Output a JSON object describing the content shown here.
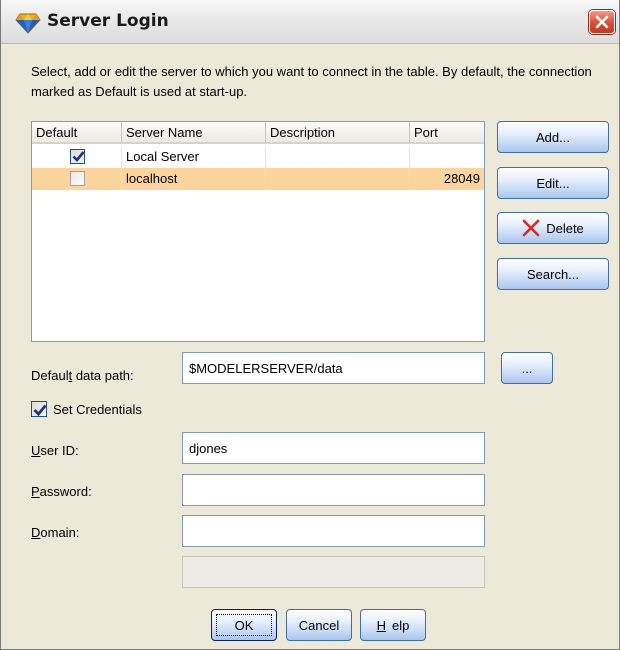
{
  "window": {
    "title": "Server Login",
    "accent_color": "#0a246a",
    "selection_color": "#fbd59c"
  },
  "instructions": "Select, add or edit the server to which you want to connect in the table. By default, the connection marked as Default is used at start-up.",
  "table": {
    "columns": [
      "Default",
      "Server Name",
      "Description",
      "Port"
    ],
    "rows": [
      {
        "default": true,
        "name": "Local Server",
        "description": "",
        "port": ""
      },
      {
        "default": false,
        "name": "localhost",
        "description": "",
        "port": "28049"
      }
    ]
  },
  "side_buttons": {
    "add": "Add...",
    "edit": "Edit...",
    "delete": "Delete",
    "search": "Search..."
  },
  "data_path": {
    "label_pre": "Defaul",
    "label_u": "t",
    "label_post": " data path:",
    "value": "$MODELERSERVER/data",
    "browse": "..."
  },
  "credentials": {
    "checked": true,
    "label": "Set Credentials",
    "user_id": {
      "label_u": "U",
      "label_rest": "ser ID:",
      "value": "djones"
    },
    "password": {
      "label_u": "P",
      "label_rest": "assword:",
      "value": ""
    },
    "domain": {
      "label_u": "D",
      "label_rest": "omain:",
      "value": ""
    }
  },
  "dialog_buttons": {
    "ok": "OK",
    "cancel": "Cancel",
    "help_u": "H",
    "help_rest": "elp"
  },
  "icons": {
    "app": "diamond-icon",
    "close": "close-x-icon",
    "delete": "red-x-icon",
    "check": "checkmark-icon"
  }
}
